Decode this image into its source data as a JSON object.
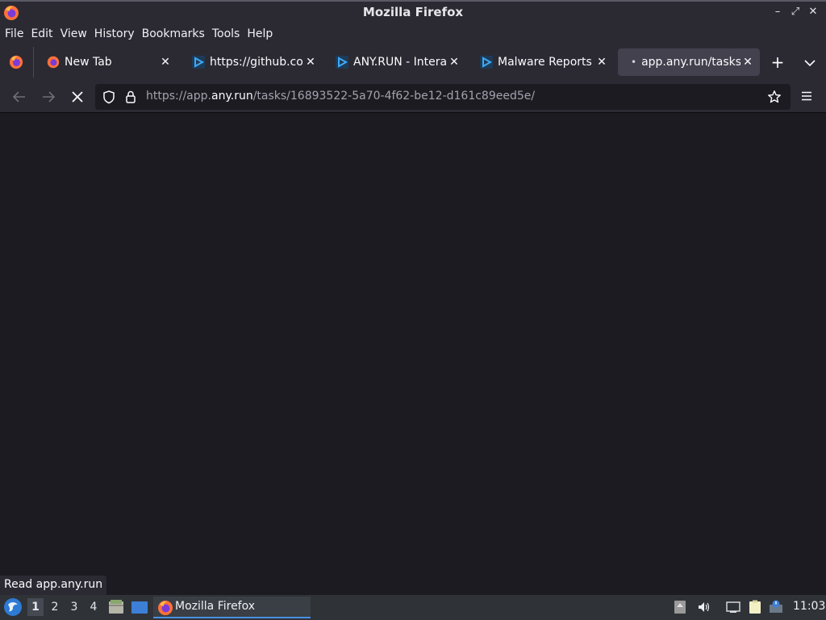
{
  "window": {
    "title": "Mozilla Firefox"
  },
  "menubar": {
    "items": [
      "File",
      "Edit",
      "View",
      "History",
      "Bookmarks",
      "Tools",
      "Help"
    ]
  },
  "tabs": [
    {
      "label": "New Tab",
      "icon": "firefox-icon"
    },
    {
      "label": "https://github.com",
      "icon": "anyrun-icon"
    },
    {
      "label": "ANY.RUN - Interact",
      "icon": "anyrun-icon"
    },
    {
      "label": "Malware Reports -",
      "icon": "anyrun-icon"
    },
    {
      "label": "app.any.run/tasks/",
      "icon": "loading-dot",
      "active": true
    }
  ],
  "urlbar": {
    "prefix": "https://app.",
    "host": "any.run",
    "path": "/tasks/16893522-5a70-4f62-be12-d161c89eed5e/"
  },
  "status": {
    "text": "Read app.any.run"
  },
  "taskbar": {
    "workspaces": [
      "1",
      "2",
      "3",
      "4"
    ],
    "active_workspace": "1",
    "task_label": "Mozilla Firefox",
    "clock": "11:03"
  },
  "colors": {
    "chrome_bg": "#2b2a33",
    "content_bg": "#1c1b22",
    "active_tab": "#42414d",
    "accent": "#4b8fe0"
  }
}
